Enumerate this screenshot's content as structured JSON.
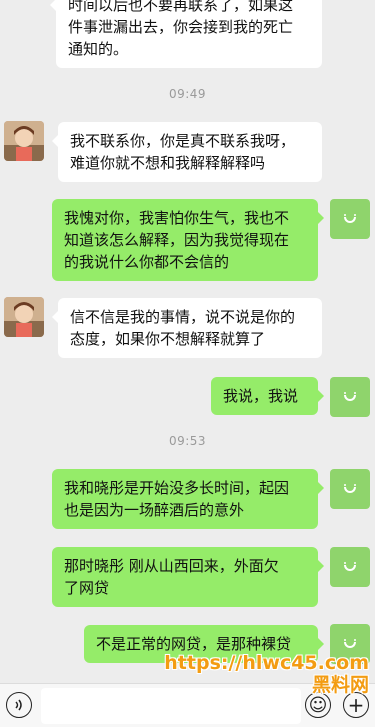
{
  "messages": [
    {
      "side": "left",
      "lines": [
        "时间以后也不要再联系了，如果这",
        "件事泄漏出去，你会接到我的死亡",
        "通知的。"
      ]
    },
    {
      "time": "09:49"
    },
    {
      "side": "left",
      "lines": [
        "我不联系你，你是真不联系我呀，",
        "难道你就不想和我解释解释吗"
      ]
    },
    {
      "side": "right",
      "lines": [
        "我愧对你，我害怕你生气，我也不",
        "知道该怎么解释，因为我觉得现在",
        "的我说什么你都不会信的"
      ]
    },
    {
      "side": "left",
      "lines": [
        "信不信是我的事情，说不说是你的",
        "态度，如果你不想解释就算了"
      ]
    },
    {
      "side": "right",
      "lines": [
        "我说，我说"
      ]
    },
    {
      "time": "09:53"
    },
    {
      "side": "right",
      "lines": [
        "我和晓彤是开始没多长时间，起因",
        "也是因为一场醉酒后的意外"
      ]
    },
    {
      "side": "right",
      "lines": [
        "那时晓彤 刚从山西回来，外面欠",
        "了网贷"
      ]
    },
    {
      "side": "right",
      "lines": [
        "不是正常的网贷，是那种裸贷"
      ]
    }
  ],
  "input_bar": {
    "voice_icon": "voice-icon",
    "emoji_icon": "emoji-icon",
    "add_icon": "plus-icon",
    "emoji_glyph": "☺",
    "plus_glyph": "+",
    "voice_glyph": "◖"
  },
  "watermark": {
    "line1": "https://hlwc45.com",
    "line2": "黑料网"
  }
}
